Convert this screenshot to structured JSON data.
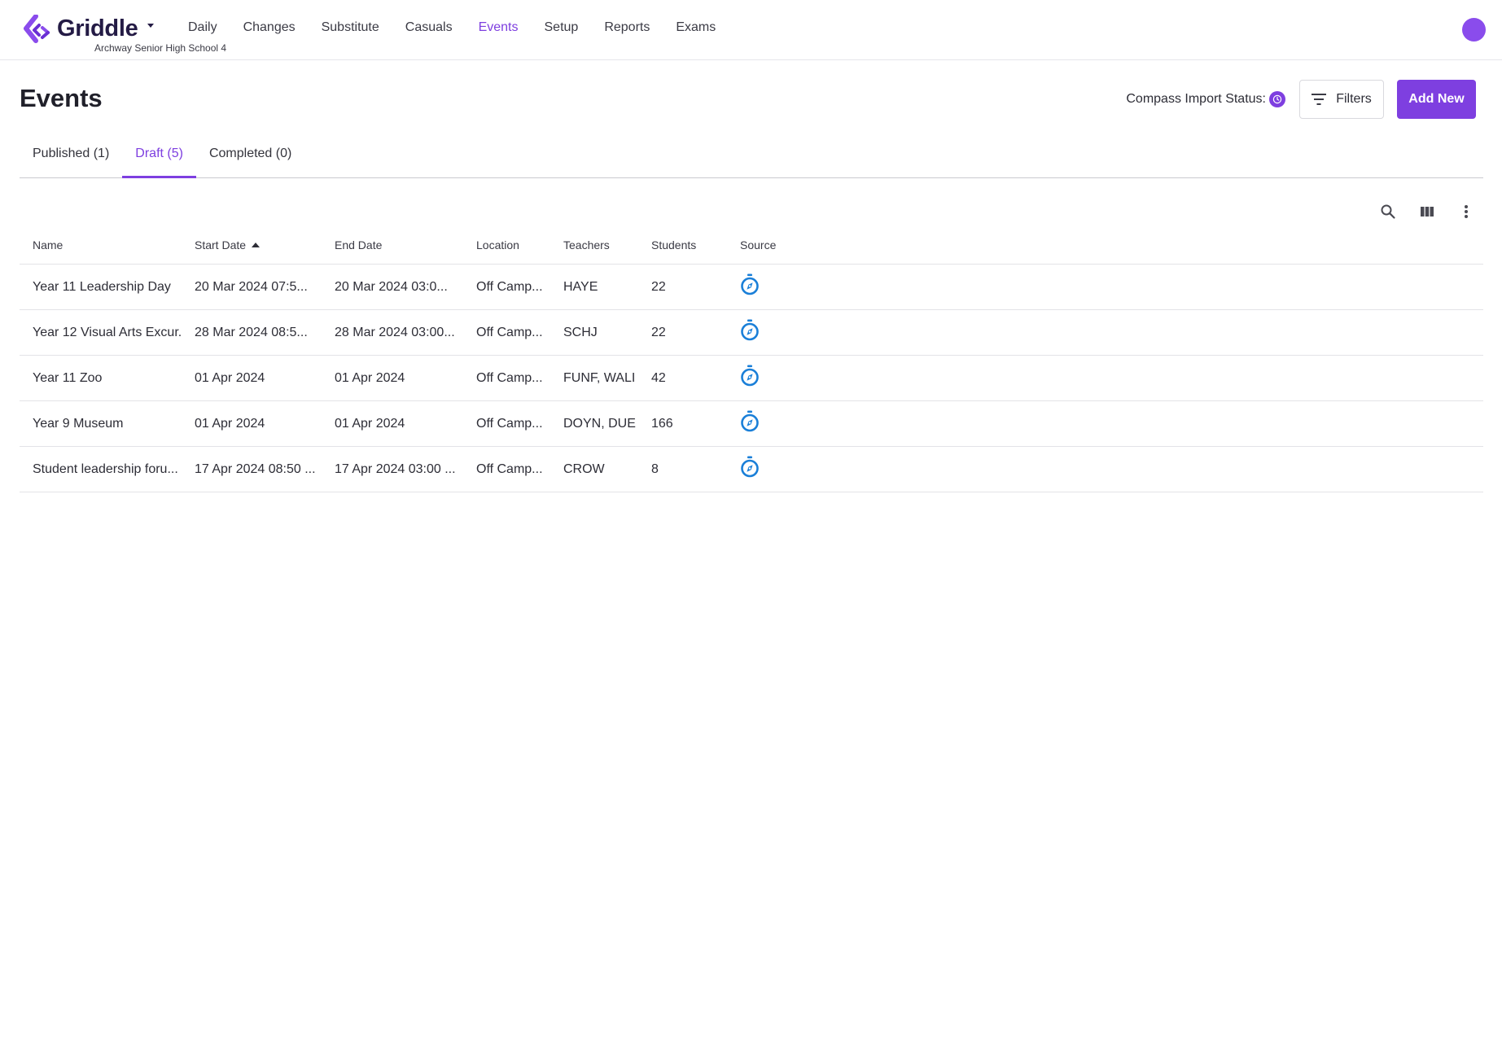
{
  "app": {
    "name": "Griddle",
    "school": "Archway Senior High School 4"
  },
  "nav": {
    "items": [
      {
        "label": "Daily"
      },
      {
        "label": "Changes"
      },
      {
        "label": "Substitute"
      },
      {
        "label": "Casuals"
      },
      {
        "label": "Events"
      },
      {
        "label": "Setup"
      },
      {
        "label": "Reports"
      },
      {
        "label": "Exams"
      }
    ],
    "active": "Events"
  },
  "page": {
    "title": "Events",
    "import_status_label": "Compass Import Status:",
    "filters_label": "Filters",
    "add_label": "Add New"
  },
  "tabs": [
    {
      "label": "Published (1)"
    },
    {
      "label": "Draft (5)"
    },
    {
      "label": "Completed (0)"
    }
  ],
  "active_tab": "Draft (5)",
  "table": {
    "columns": [
      "Name",
      "Start Date",
      "End Date",
      "Location",
      "Teachers",
      "Students",
      "Source"
    ],
    "sorted_column": "Start Date",
    "sort_direction": "ascending",
    "rows": [
      {
        "name": "Year 11 Leadership Day",
        "start": "20 Mar 2024 07:5...",
        "end": "20 Mar 2024 03:0...",
        "location": "Off Camp...",
        "teachers": "HAYE",
        "students": "22",
        "source": "compass-icon"
      },
      {
        "name": "Year 12 Visual Arts Excur...",
        "start": "28 Mar 2024 08:5...",
        "end": "28 Mar 2024 03:00...",
        "location": "Off Camp...",
        "teachers": "SCHJ",
        "students": "22",
        "source": "compass-icon"
      },
      {
        "name": "Year 11 Zoo",
        "start": "01 Apr 2024",
        "end": "01 Apr 2024",
        "location": "Off Camp...",
        "teachers": "FUNF, WALI",
        "students": "42",
        "source": "compass-icon"
      },
      {
        "name": "Year 9 Museum",
        "start": "01 Apr 2024",
        "end": "01 Apr 2024",
        "location": "Off Camp...",
        "teachers": "DOYN, DUE",
        "students": "166",
        "source": "compass-icon"
      },
      {
        "name": "Student leadership foru...",
        "start": "17 Apr 2024 08:50 ...",
        "end": "17 Apr 2024 03:00 ...",
        "location": "Off Camp...",
        "teachers": "CROW",
        "students": "8",
        "source": "compass-icon"
      }
    ]
  },
  "colors": {
    "accent": "#7e3fe0",
    "source_icon": "#1a7fd8",
    "brand_text": "#241b45"
  }
}
